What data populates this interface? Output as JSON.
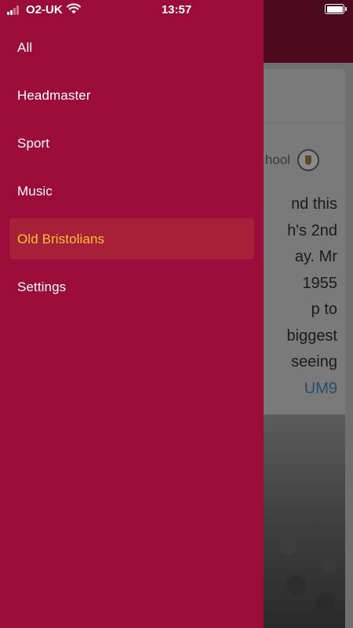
{
  "status_bar": {
    "carrier": "O2-UK",
    "time": "13:57",
    "icons": [
      "signal-icon",
      "wifi-icon",
      "battery-icon"
    ]
  },
  "drawer": {
    "background_color": "#9b0c3b",
    "active_color": "#ffc13b",
    "items": [
      {
        "label": "All",
        "active": false
      },
      {
        "label": "Headmaster",
        "active": false
      },
      {
        "label": "Sport",
        "active": false
      },
      {
        "label": "Music",
        "active": false
      },
      {
        "label": "Old Bristolians",
        "active": true
      },
      {
        "label": "Settings",
        "active": false
      }
    ]
  },
  "background_post": {
    "account_text": "hool",
    "lines": [
      "nd this",
      "h's 2nd",
      "ay. Mr",
      "1955",
      "p to",
      "biggest",
      "seeing"
    ],
    "link_text": "UM9"
  }
}
